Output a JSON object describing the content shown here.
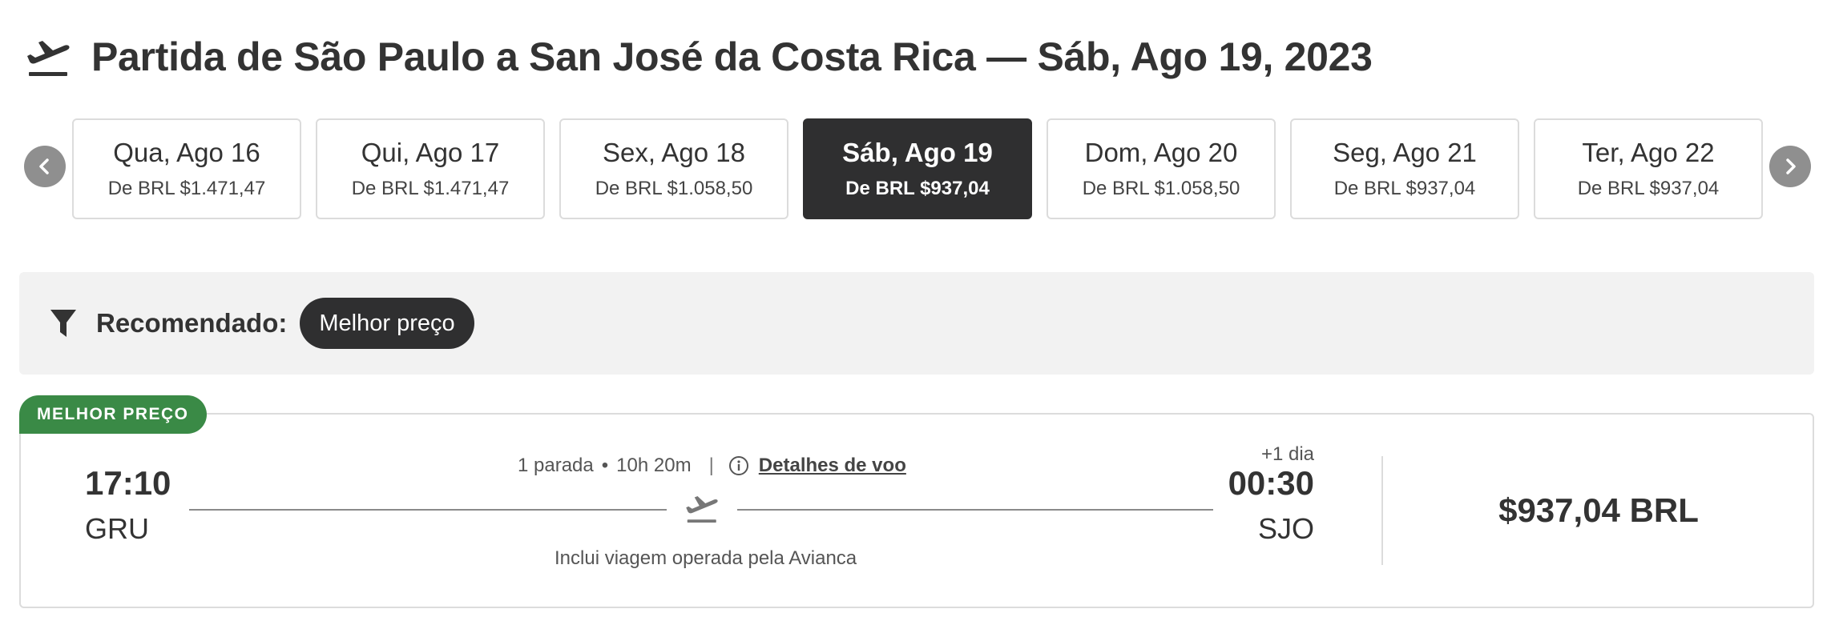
{
  "header": {
    "title": "Partida de São Paulo a San José da Costa Rica — Sáb, Ago 19, 2023",
    "icon": "airplane-departure-icon"
  },
  "date_strip": {
    "prev_icon": "chevron-left-icon",
    "next_icon": "chevron-right-icon",
    "dates": [
      {
        "date": "Qua, Ago 16",
        "price": "De BRL $1.471,47",
        "selected": false
      },
      {
        "date": "Qui, Ago 17",
        "price": "De BRL $1.471,47",
        "selected": false
      },
      {
        "date": "Sex, Ago 18",
        "price": "De BRL $1.058,50",
        "selected": false
      },
      {
        "date": "Sáb, Ago 19",
        "price": "De BRL $937,04",
        "selected": true
      },
      {
        "date": "Dom, Ago 20",
        "price": "De BRL $1.058,50",
        "selected": false
      },
      {
        "date": "Seg, Ago 21",
        "price": "De BRL $937,04",
        "selected": false
      },
      {
        "date": "Ter, Ago 22",
        "price": "De BRL $937,04",
        "selected": false
      }
    ]
  },
  "filter": {
    "icon": "funnel-icon",
    "label": "Recomendado:",
    "pill": "Melhor preço"
  },
  "result": {
    "badge": "MELHOR PREÇO",
    "badge_color": "#3a8a46",
    "departure_time": "17:10",
    "departure_code": "GRU",
    "arrival_time": "00:30",
    "arrival_code": "SJO",
    "arrival_day_offset": "+1 dia",
    "stops": "1 parada",
    "duration": "10h 20m",
    "details_link": "Detalhes de voo",
    "operated_by": "Inclui viagem operada pela Avianca",
    "price": "$937,04 BRL"
  },
  "colors": {
    "selected_card": "#2f2f30",
    "filter_bg": "#f2f2f2",
    "nav_button": "#8f8f8f"
  }
}
